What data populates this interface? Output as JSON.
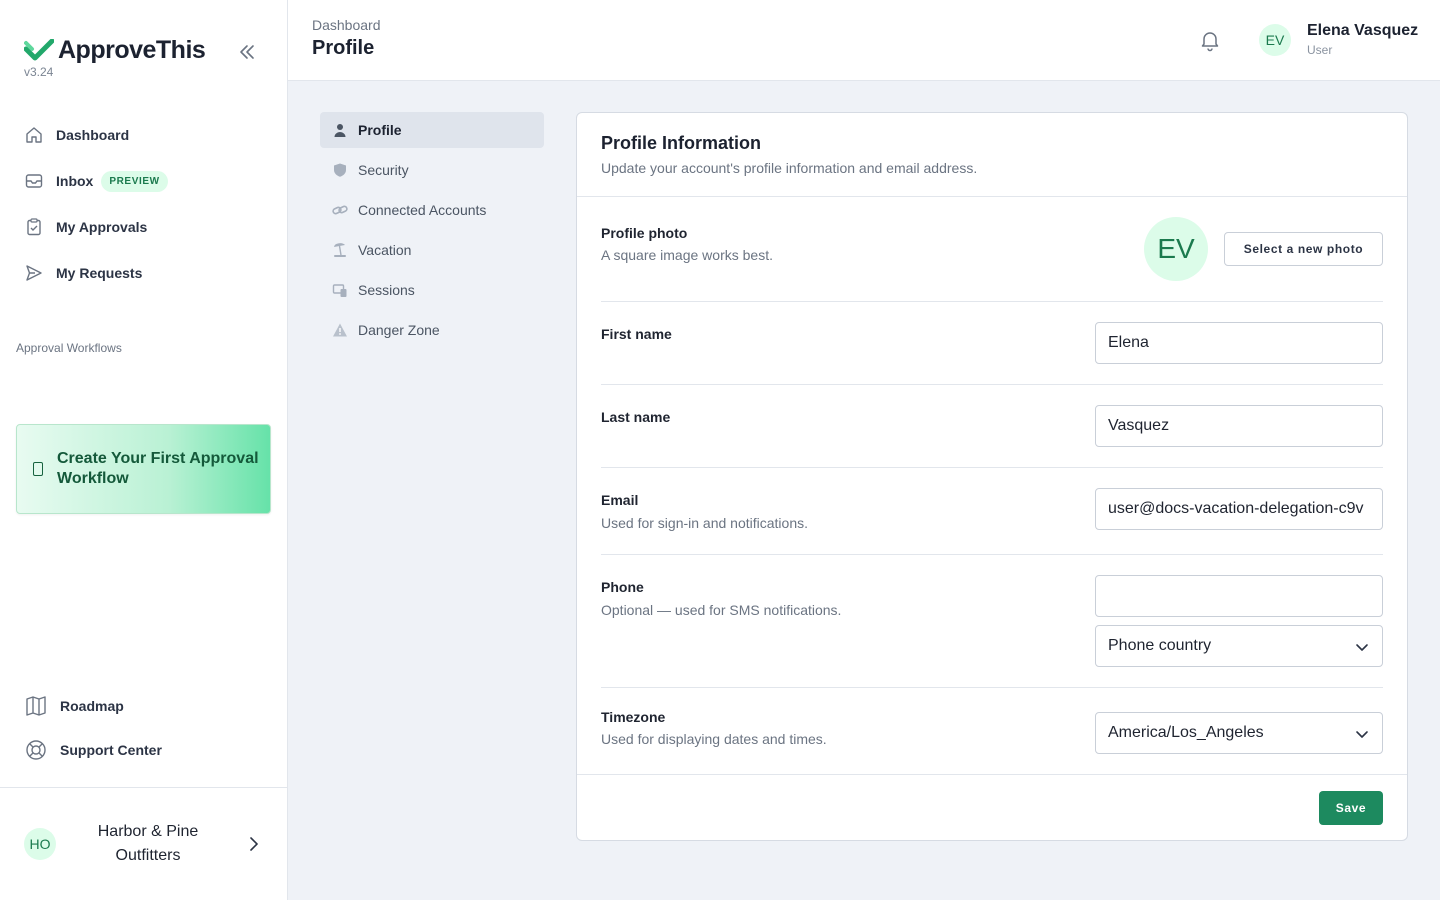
{
  "brand": {
    "name": "ApproveThis",
    "version": "v3.24"
  },
  "sidebar": {
    "items": [
      {
        "label": "Dashboard",
        "icon": "home-icon"
      },
      {
        "label": "Inbox",
        "icon": "inbox-icon",
        "badge": "PREVIEW"
      },
      {
        "label": "My Approvals",
        "icon": "clipboard-check-icon"
      },
      {
        "label": "My Requests",
        "icon": "send-icon"
      }
    ],
    "section_label": "Approval Workflows",
    "cta_label": "Create Your First Approval Workflow",
    "bottom_items": [
      {
        "label": "Roadmap",
        "icon": "map-icon"
      },
      {
        "label": "Support Center",
        "icon": "lifebuoy-icon"
      }
    ],
    "org": {
      "initials": "HO",
      "name": "Harbor & Pine Outfitters"
    }
  },
  "header": {
    "breadcrumb": "Dashboard",
    "title": "Profile",
    "user": {
      "initials": "EV",
      "name": "Elena Vasquez",
      "role": "User"
    }
  },
  "settings_nav": {
    "items": [
      {
        "label": "Profile",
        "icon": "user-icon",
        "active": true
      },
      {
        "label": "Security",
        "icon": "shield-icon"
      },
      {
        "label": "Connected Accounts",
        "icon": "link-icon"
      },
      {
        "label": "Vacation",
        "icon": "beach-icon"
      },
      {
        "label": "Sessions",
        "icon": "devices-icon"
      },
      {
        "label": "Danger Zone",
        "icon": "warning-icon"
      }
    ]
  },
  "card": {
    "title": "Profile Information",
    "subtitle": "Update your account's profile information and email address.",
    "photo": {
      "label": "Profile photo",
      "help": "A square image works best.",
      "initials": "EV",
      "button": "Select a new photo"
    },
    "first_name": {
      "label": "First name",
      "value": "Elena"
    },
    "last_name": {
      "label": "Last name",
      "value": "Vasquez"
    },
    "email": {
      "label": "Email",
      "help": "Used for sign-in and notifications.",
      "value": "user@docs-vacation-delegation-c9v"
    },
    "phone": {
      "label": "Phone",
      "help": "Optional — used for SMS notifications.",
      "value": "",
      "country_placeholder": "Phone country"
    },
    "timezone": {
      "label": "Timezone",
      "help": "Used for displaying dates and times.",
      "value": "America/Los_Angeles"
    },
    "save_label": "Save"
  },
  "colors": {
    "accent": "#1d8a5f",
    "accent_light": "#dcfce9",
    "background": "#eff2f7"
  }
}
